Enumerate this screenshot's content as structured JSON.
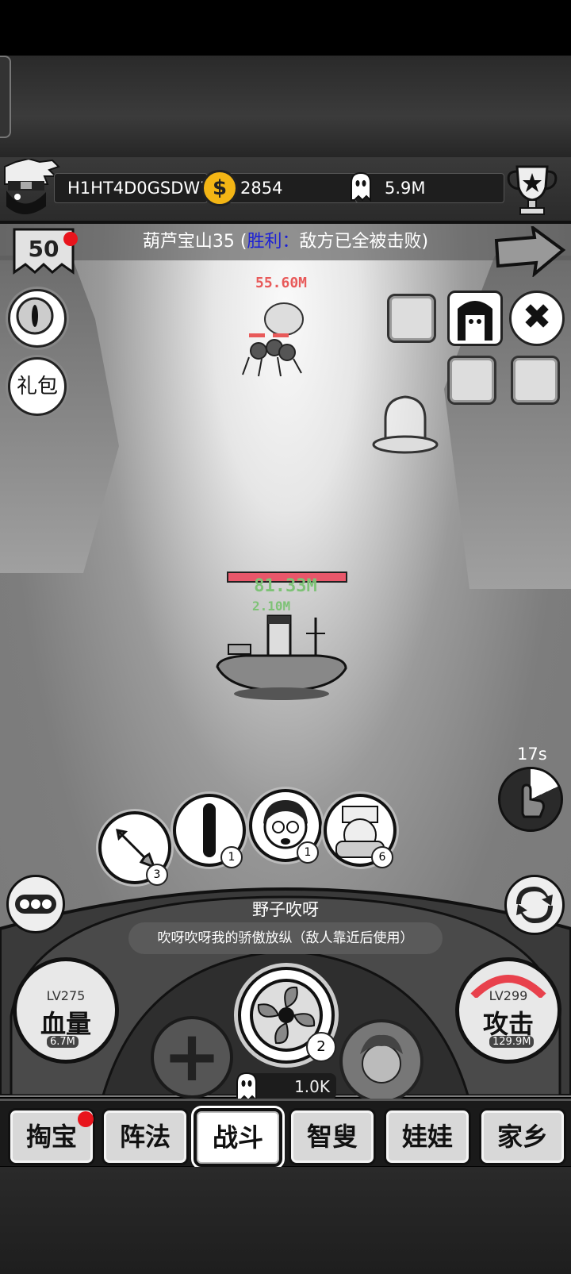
{
  "header": {
    "player_id": "H1HT4D0GSDW7",
    "coins": "2854",
    "coin_icon_symbol": "$",
    "ghost_currency": "5.9M"
  },
  "stage": {
    "flag_level": "50",
    "title_prefix": "葫芦宝山35 (",
    "result": "胜利：",
    "result_detail": "敌方已全被击败)",
    "result_color": "#1c20d6"
  },
  "left_buttons": {
    "gift_label": "礼包"
  },
  "right_buttons": {
    "close_symbol": "✖"
  },
  "battle": {
    "enemy_damage": "55.60M",
    "player_hp": "81.33M",
    "player_hp_color": "#7ec276",
    "damage_popup": "2.10M",
    "auto_timer": "17s",
    "auto_timer_progress": 0.18
  },
  "skills": [
    {
      "name": "rocket-skill",
      "count": "3"
    },
    {
      "name": "bar-skill",
      "count": "1"
    },
    {
      "name": "hero-portrait-skill",
      "count": "1"
    },
    {
      "name": "bandage-hero-skill",
      "count": "6"
    }
  ],
  "skill_info": {
    "name": "野子吹呀",
    "description": "吹呀吹呀我的骄傲放纵（敌人靠近后使用）"
  },
  "stats": {
    "hp": {
      "level": "LV275",
      "label": "血量",
      "cost": "6.7M"
    },
    "attack": {
      "level": "LV299",
      "label": "攻击",
      "cost": "129.9M"
    }
  },
  "fan": {
    "count": "2"
  },
  "cost": "1.0K",
  "plus_symbol": "+",
  "tabs": [
    {
      "label": "掏宝",
      "active": false
    },
    {
      "label": "阵法",
      "active": false
    },
    {
      "label": "战斗",
      "active": true
    },
    {
      "label": "智叟",
      "active": false
    },
    {
      "label": "娃娃",
      "active": false
    },
    {
      "label": "家乡",
      "active": false
    }
  ]
}
